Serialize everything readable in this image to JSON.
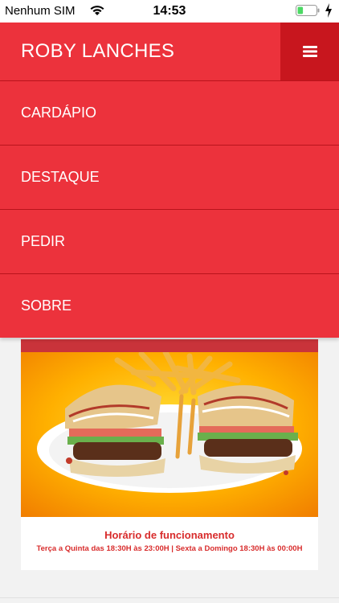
{
  "status_bar": {
    "carrier": "Nenhum SIM",
    "time": "14:53",
    "battery_level": 0.3,
    "charging": true
  },
  "header": {
    "brand": "ROBY LANCHES",
    "menu_icon": "hamburger-icon"
  },
  "menu": {
    "items": [
      {
        "label": "CARDÁPIO"
      },
      {
        "label": "DESTAQUE"
      },
      {
        "label": "PEDIR"
      },
      {
        "label": "SOBRE"
      }
    ]
  },
  "content": {
    "image": "burger-fries-promo-image",
    "hours_title": "Horário de funcionamento",
    "hours_detail": "Terça a Quinta das 18:30H às 23:00H | Sexta a Domingo 18:30H às 00:00H"
  },
  "colors": {
    "primary": "#ec323c",
    "primary_dark": "#c8161e",
    "text_accent": "#d82c2c"
  }
}
